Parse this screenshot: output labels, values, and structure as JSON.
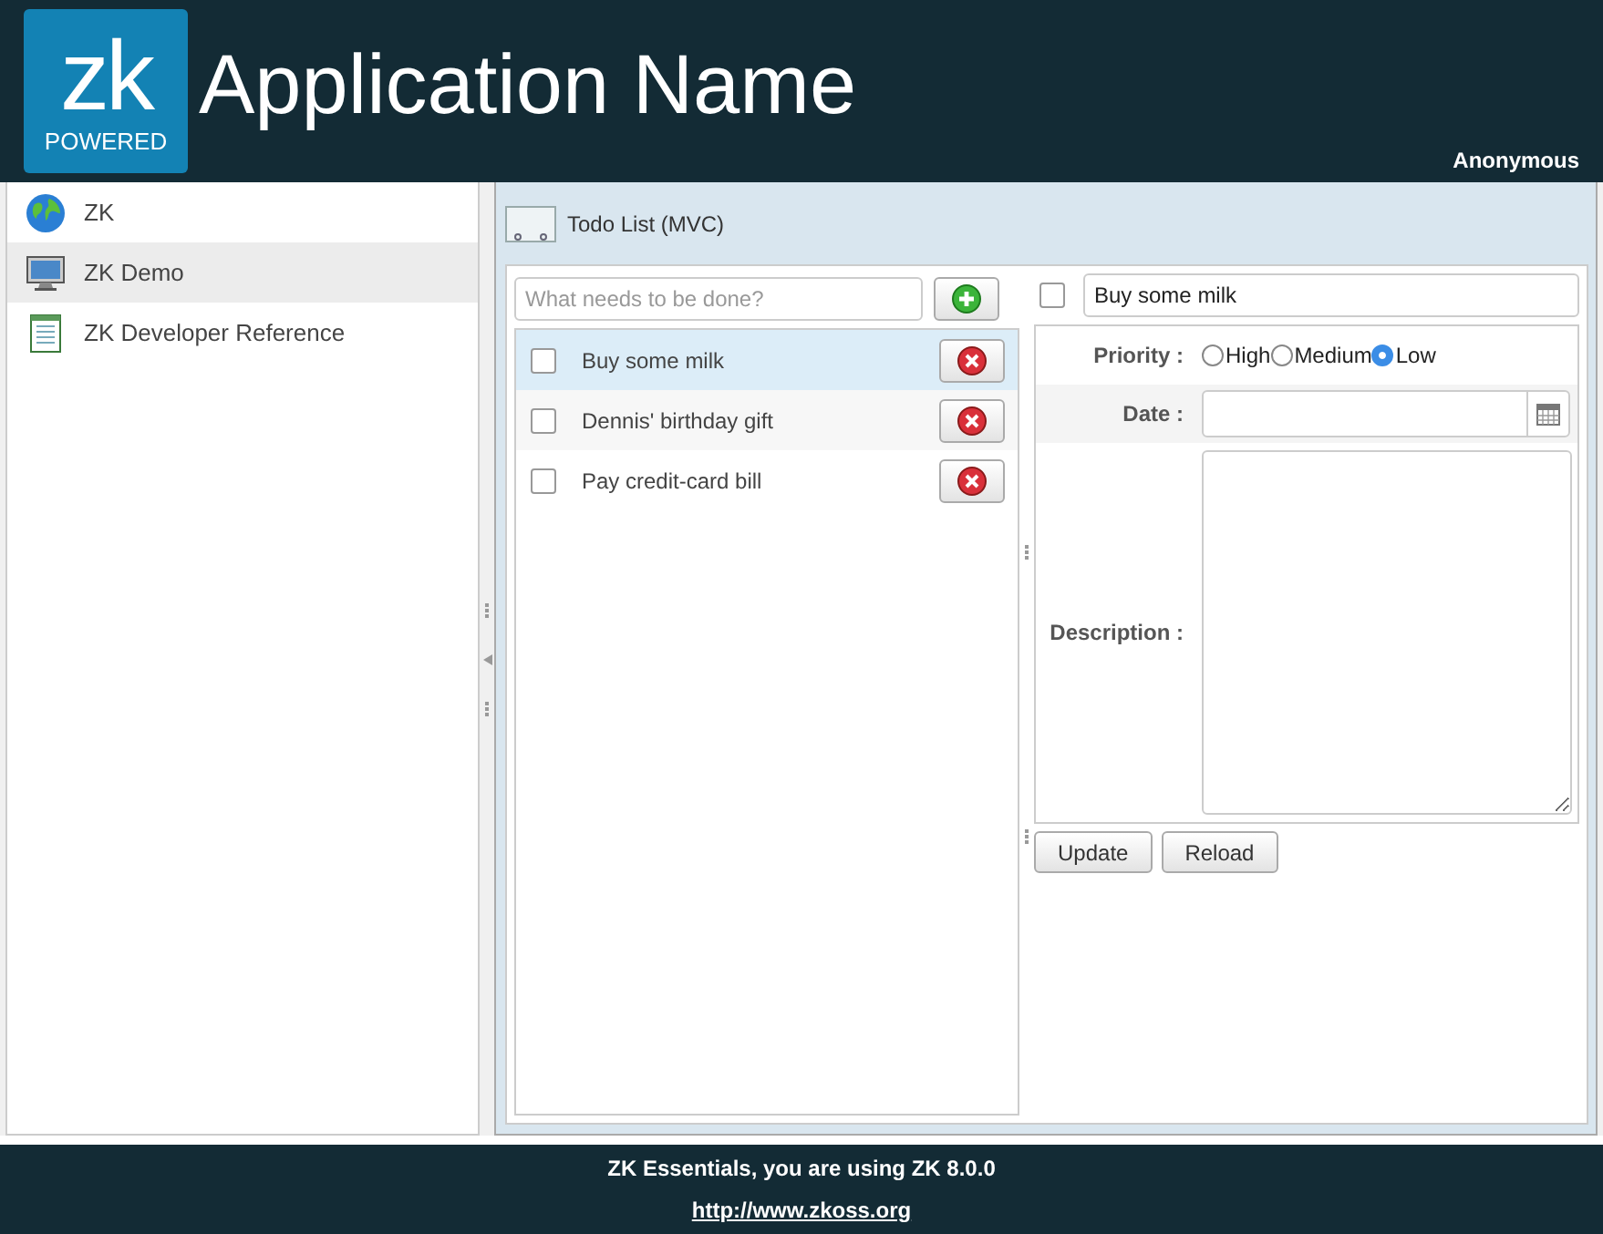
{
  "header": {
    "logo_mark": "zk",
    "logo_caption": "POWERED",
    "app_name": "Application Name",
    "user": "Anonymous"
  },
  "sidebar": {
    "items": [
      {
        "label": "ZK",
        "selected": false
      },
      {
        "label": "ZK Demo",
        "selected": true
      },
      {
        "label": "ZK Developer Reference",
        "selected": false
      }
    ]
  },
  "tab": {
    "label": "Todo List (MVC)"
  },
  "todo": {
    "placeholder": "What needs to be done?",
    "items": [
      {
        "text": "Buy some milk",
        "checked": false,
        "selected": true
      },
      {
        "text": "Dennis' birthday gift",
        "checked": false,
        "selected": false
      },
      {
        "text": "Pay credit-card bill",
        "checked": false,
        "selected": false
      }
    ]
  },
  "detail": {
    "checked": false,
    "title": "Buy some milk",
    "priority_label": "Priority :",
    "priorities": [
      {
        "label": "High",
        "selected": false
      },
      {
        "label": "Medium",
        "selected": false
      },
      {
        "label": "Low",
        "selected": true
      }
    ],
    "date_label": "Date :",
    "description_label": "Description :",
    "buttons": [
      "Update",
      "Reload"
    ]
  },
  "footer": {
    "text": "ZK Essentials, you are using ZK 8.0.0",
    "link": "http://www.zkoss.org"
  }
}
